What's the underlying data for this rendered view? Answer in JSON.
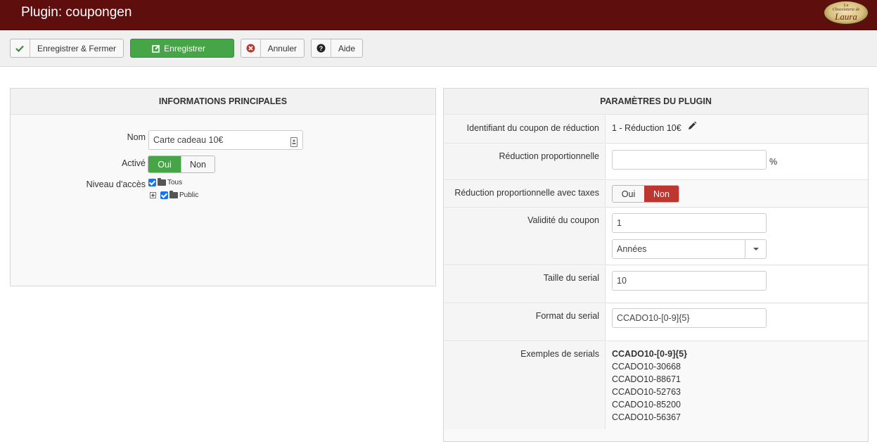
{
  "header": {
    "title": "Plugin: coupongen",
    "logo": {
      "line1": "La",
      "line2": "Chocolaterie de",
      "line3": "Laura"
    }
  },
  "toolbar": {
    "save_close_label": "Enregistrer & Fermer",
    "save_label": "Enregistrer",
    "cancel_label": "Annuler",
    "help_label": "Aide"
  },
  "main_info": {
    "title": "INFORMATIONS PRINCIPALES",
    "name_label": "Nom",
    "name_value": "Carte cadeau 10€",
    "active_label": "Activé",
    "active_yes": "Oui",
    "active_no": "Non",
    "active_selected": "Oui",
    "access_label": "Niveau d'accès",
    "access_tree": [
      {
        "label": "Tous",
        "checked": true
      },
      {
        "label": "Public",
        "checked": true
      }
    ]
  },
  "plugin_params": {
    "title": "PARAMÈTRES DU PLUGIN",
    "coupon_id_label": "Identifiant du coupon de réduction",
    "coupon_id_value": "1 - Réduction 10€",
    "prop_reduction_label": "Réduction proportionnelle",
    "prop_reduction_value": "",
    "prop_reduction_unit": "%",
    "prop_taxes_label": "Réduction proportionnelle avec taxes",
    "prop_taxes_yes": "Oui",
    "prop_taxes_no": "Non",
    "prop_taxes_selected": "Non",
    "validity_label": "Validité du coupon",
    "validity_value": "1",
    "validity_unit": "Années",
    "serial_size_label": "Taille du serial",
    "serial_size_value": "10",
    "serial_format_label": "Format du serial",
    "serial_format_value": "CCADO10-[0-9]{5}",
    "serial_examples_label": "Exemples de serials",
    "serial_examples_title": "CCADO10-[0-9]{5}",
    "serial_examples": [
      "CCADO10-30668",
      "CCADO10-88671",
      "CCADO10-52763",
      "CCADO10-85200",
      "CCADO10-56367"
    ]
  },
  "colors": {
    "header_bg": "#5f0e0e",
    "success": "#46a546",
    "danger": "#bd362f"
  }
}
